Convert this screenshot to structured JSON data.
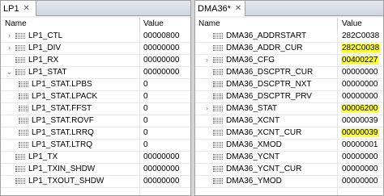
{
  "left": {
    "tab_title": "LP1",
    "col_name": "Name",
    "col_value": "Value",
    "rows": [
      {
        "name": "LP1_CTL",
        "value": "00000800",
        "expander": ">",
        "indent": 0,
        "highlight": false
      },
      {
        "name": "LP1_DIV",
        "value": "00000000",
        "expander": ">",
        "indent": 0,
        "highlight": false
      },
      {
        "name": "LP1_RX",
        "value": "00000000",
        "expander": "",
        "indent": 0,
        "highlight": false
      },
      {
        "name": "LP1_STAT",
        "value": "00000000",
        "expander": "v",
        "indent": 0,
        "highlight": false
      },
      {
        "name": "LP1_STAT.LPBS",
        "value": "0",
        "expander": "",
        "indent": 1,
        "highlight": false
      },
      {
        "name": "LP1_STAT.LPACK",
        "value": "0",
        "expander": "",
        "indent": 1,
        "highlight": false
      },
      {
        "name": "LP1_STAT.FFST",
        "value": "0",
        "expander": "",
        "indent": 1,
        "highlight": false
      },
      {
        "name": "LP1_STAT.ROVF",
        "value": "0",
        "expander": "",
        "indent": 1,
        "highlight": false
      },
      {
        "name": "LP1_STAT.LRRQ",
        "value": "0",
        "expander": "",
        "indent": 1,
        "highlight": false
      },
      {
        "name": "LP1_STAT.LTRQ",
        "value": "0",
        "expander": "",
        "indent": 1,
        "highlight": false
      },
      {
        "name": "LP1_TX",
        "value": "00000000",
        "expander": "",
        "indent": 0,
        "highlight": false
      },
      {
        "name": "LP1_TXIN_SHDW",
        "value": "00000000",
        "expander": "",
        "indent": 0,
        "highlight": false
      },
      {
        "name": "LP1_TXOUT_SHDW",
        "value": "00000000",
        "expander": "",
        "indent": 0,
        "highlight": false
      }
    ]
  },
  "right": {
    "tab_title": "DMA36*",
    "col_name": "Name",
    "col_value": "Value",
    "rows": [
      {
        "name": "DMA36_ADDRSTART",
        "value": "282C0038",
        "expander": "",
        "highlight": false
      },
      {
        "name": "DMA36_ADDR_CUR",
        "value": "282C0038",
        "expander": "",
        "highlight": true
      },
      {
        "name": "DMA36_CFG",
        "value": "00400227",
        "expander": ">",
        "highlight": true
      },
      {
        "name": "DMA36_DSCPTR_CUR",
        "value": "00000000",
        "expander": "",
        "highlight": false
      },
      {
        "name": "DMA36_DSCPTR_NXT",
        "value": "00000000",
        "expander": "",
        "highlight": false
      },
      {
        "name": "DMA36_DSCPTR_PRV",
        "value": "00000000",
        "expander": "",
        "highlight": false
      },
      {
        "name": "DMA36_STAT",
        "value": "00006200",
        "expander": ">",
        "highlight": true
      },
      {
        "name": "DMA36_XCNT",
        "value": "00000039",
        "expander": "",
        "highlight": false
      },
      {
        "name": "DMA36_XCNT_CUR",
        "value": "00000039",
        "expander": "",
        "highlight": true
      },
      {
        "name": "DMA36_XMOD",
        "value": "00000001",
        "expander": "",
        "highlight": false
      },
      {
        "name": "DMA36_YCNT",
        "value": "00000000",
        "expander": "",
        "highlight": false
      },
      {
        "name": "DMA36_YCNT_CUR",
        "value": "00000000",
        "expander": "",
        "highlight": false
      },
      {
        "name": "DMA36_YMOD",
        "value": "00000000",
        "expander": "",
        "highlight": false
      }
    ]
  },
  "icons": {
    "close": "close-icon",
    "register": "register-icon",
    "expand": "chevron-right-icon",
    "collapse": "chevron-down-icon"
  },
  "colors": {
    "highlight": "#ffff33",
    "tab_bg": "#ffffff",
    "border": "#a0a0a0"
  }
}
